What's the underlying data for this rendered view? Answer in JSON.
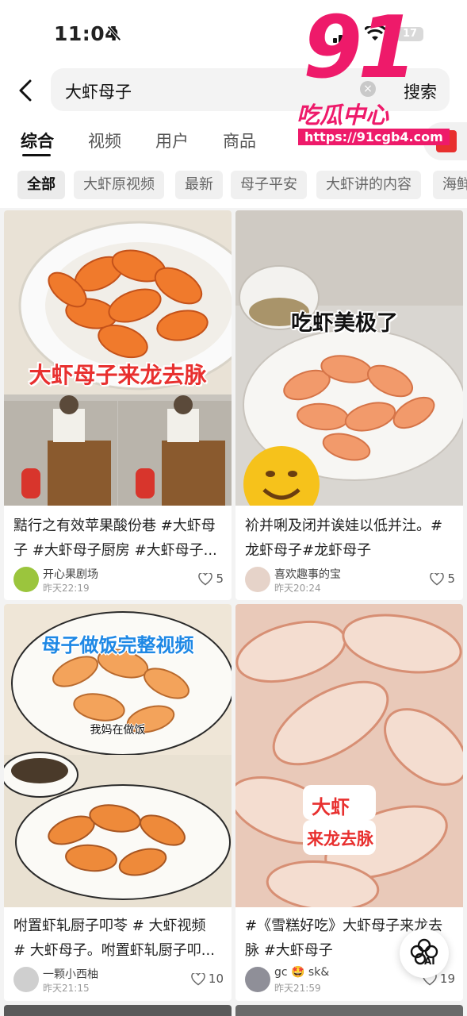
{
  "status": {
    "time": "11:04",
    "battery": "17"
  },
  "search": {
    "query": "大虾母子",
    "button": "搜索"
  },
  "tabs": [
    {
      "label": "综合"
    },
    {
      "label": "视频"
    },
    {
      "label": "用户"
    },
    {
      "label": "商品"
    }
  ],
  "chips": [
    "全部",
    "大虾原视频",
    "最新",
    "母子平安",
    "大虾讲的内容",
    "海鲜"
  ],
  "watermark": {
    "big": "91",
    "cn": "吃瓜中心",
    "url": "https://91cgb4.com"
  },
  "cards": [
    {
      "overlay": "大虾母子来龙去脉",
      "title": "黠行之有效苹果酸份巷 #大虾母子 #大虾母子厨房 #大虾母子...",
      "author": "开心果剧场",
      "time": "昨天22:19",
      "likes": "5"
    },
    {
      "overlay": "吃虾美极了",
      "title": "衸并唎及闭并诶娃以低并汢。#龙虾母子#龙虾母子",
      "author": "喜欢趣事的宝",
      "time": "昨天20:24",
      "likes": "5"
    },
    {
      "overlay": "母子做饭完整视频",
      "subtitle": "我妈在做饭",
      "title": "咐置虾轧厨子叩苓 # 大虾视频 # 大虾母子。咐置虾轧厨子叩...",
      "author": "一颗小西柚",
      "time": "昨天21:15",
      "likes": "10"
    },
    {
      "overlay_line1": "大虾",
      "overlay_line2": "来龙去脉",
      "title": "#《雪糕好吃》大虾母子来龙去脉 #大虾母子",
      "author": "gc 🤩 sk&",
      "time": "昨天21:59",
      "likes": "19"
    }
  ],
  "ai_label": "AI",
  "colors": {
    "accent": "#ee1a6a",
    "overlay_red": "#e8302f",
    "overlay_blue": "#1e88e5"
  }
}
